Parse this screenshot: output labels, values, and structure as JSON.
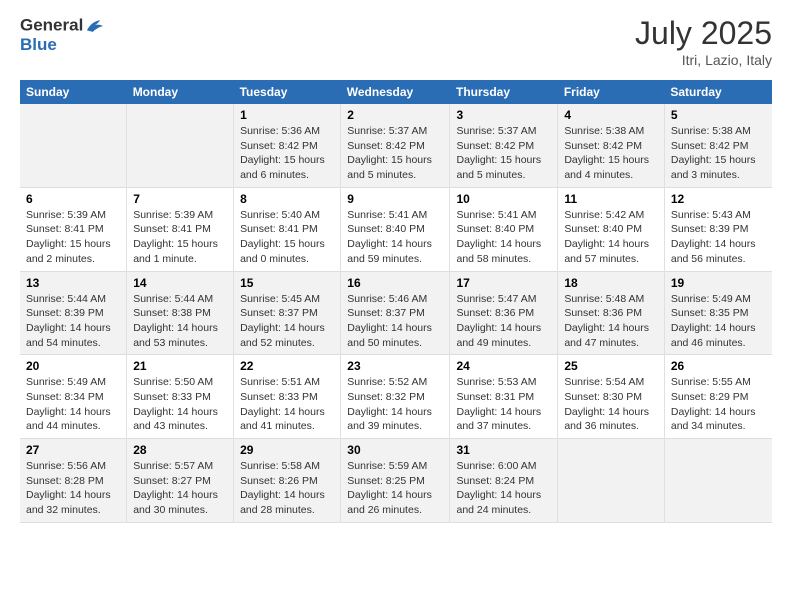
{
  "header": {
    "logo_general": "General",
    "logo_blue": "Blue",
    "month_year": "July 2025",
    "location": "Itri, Lazio, Italy"
  },
  "days_of_week": [
    "Sunday",
    "Monday",
    "Tuesday",
    "Wednesday",
    "Thursday",
    "Friday",
    "Saturday"
  ],
  "weeks": [
    [
      {
        "day": "",
        "sunrise": "",
        "sunset": "",
        "daylight": ""
      },
      {
        "day": "",
        "sunrise": "",
        "sunset": "",
        "daylight": ""
      },
      {
        "day": "1",
        "sunrise": "Sunrise: 5:36 AM",
        "sunset": "Sunset: 8:42 PM",
        "daylight": "Daylight: 15 hours and 6 minutes."
      },
      {
        "day": "2",
        "sunrise": "Sunrise: 5:37 AM",
        "sunset": "Sunset: 8:42 PM",
        "daylight": "Daylight: 15 hours and 5 minutes."
      },
      {
        "day": "3",
        "sunrise": "Sunrise: 5:37 AM",
        "sunset": "Sunset: 8:42 PM",
        "daylight": "Daylight: 15 hours and 5 minutes."
      },
      {
        "day": "4",
        "sunrise": "Sunrise: 5:38 AM",
        "sunset": "Sunset: 8:42 PM",
        "daylight": "Daylight: 15 hours and 4 minutes."
      },
      {
        "day": "5",
        "sunrise": "Sunrise: 5:38 AM",
        "sunset": "Sunset: 8:42 PM",
        "daylight": "Daylight: 15 hours and 3 minutes."
      }
    ],
    [
      {
        "day": "6",
        "sunrise": "Sunrise: 5:39 AM",
        "sunset": "Sunset: 8:41 PM",
        "daylight": "Daylight: 15 hours and 2 minutes."
      },
      {
        "day": "7",
        "sunrise": "Sunrise: 5:39 AM",
        "sunset": "Sunset: 8:41 PM",
        "daylight": "Daylight: 15 hours and 1 minute."
      },
      {
        "day": "8",
        "sunrise": "Sunrise: 5:40 AM",
        "sunset": "Sunset: 8:41 PM",
        "daylight": "Daylight: 15 hours and 0 minutes."
      },
      {
        "day": "9",
        "sunrise": "Sunrise: 5:41 AM",
        "sunset": "Sunset: 8:40 PM",
        "daylight": "Daylight: 14 hours and 59 minutes."
      },
      {
        "day": "10",
        "sunrise": "Sunrise: 5:41 AM",
        "sunset": "Sunset: 8:40 PM",
        "daylight": "Daylight: 14 hours and 58 minutes."
      },
      {
        "day": "11",
        "sunrise": "Sunrise: 5:42 AM",
        "sunset": "Sunset: 8:40 PM",
        "daylight": "Daylight: 14 hours and 57 minutes."
      },
      {
        "day": "12",
        "sunrise": "Sunrise: 5:43 AM",
        "sunset": "Sunset: 8:39 PM",
        "daylight": "Daylight: 14 hours and 56 minutes."
      }
    ],
    [
      {
        "day": "13",
        "sunrise": "Sunrise: 5:44 AM",
        "sunset": "Sunset: 8:39 PM",
        "daylight": "Daylight: 14 hours and 54 minutes."
      },
      {
        "day": "14",
        "sunrise": "Sunrise: 5:44 AM",
        "sunset": "Sunset: 8:38 PM",
        "daylight": "Daylight: 14 hours and 53 minutes."
      },
      {
        "day": "15",
        "sunrise": "Sunrise: 5:45 AM",
        "sunset": "Sunset: 8:37 PM",
        "daylight": "Daylight: 14 hours and 52 minutes."
      },
      {
        "day": "16",
        "sunrise": "Sunrise: 5:46 AM",
        "sunset": "Sunset: 8:37 PM",
        "daylight": "Daylight: 14 hours and 50 minutes."
      },
      {
        "day": "17",
        "sunrise": "Sunrise: 5:47 AM",
        "sunset": "Sunset: 8:36 PM",
        "daylight": "Daylight: 14 hours and 49 minutes."
      },
      {
        "day": "18",
        "sunrise": "Sunrise: 5:48 AM",
        "sunset": "Sunset: 8:36 PM",
        "daylight": "Daylight: 14 hours and 47 minutes."
      },
      {
        "day": "19",
        "sunrise": "Sunrise: 5:49 AM",
        "sunset": "Sunset: 8:35 PM",
        "daylight": "Daylight: 14 hours and 46 minutes."
      }
    ],
    [
      {
        "day": "20",
        "sunrise": "Sunrise: 5:49 AM",
        "sunset": "Sunset: 8:34 PM",
        "daylight": "Daylight: 14 hours and 44 minutes."
      },
      {
        "day": "21",
        "sunrise": "Sunrise: 5:50 AM",
        "sunset": "Sunset: 8:33 PM",
        "daylight": "Daylight: 14 hours and 43 minutes."
      },
      {
        "day": "22",
        "sunrise": "Sunrise: 5:51 AM",
        "sunset": "Sunset: 8:33 PM",
        "daylight": "Daylight: 14 hours and 41 minutes."
      },
      {
        "day": "23",
        "sunrise": "Sunrise: 5:52 AM",
        "sunset": "Sunset: 8:32 PM",
        "daylight": "Daylight: 14 hours and 39 minutes."
      },
      {
        "day": "24",
        "sunrise": "Sunrise: 5:53 AM",
        "sunset": "Sunset: 8:31 PM",
        "daylight": "Daylight: 14 hours and 37 minutes."
      },
      {
        "day": "25",
        "sunrise": "Sunrise: 5:54 AM",
        "sunset": "Sunset: 8:30 PM",
        "daylight": "Daylight: 14 hours and 36 minutes."
      },
      {
        "day": "26",
        "sunrise": "Sunrise: 5:55 AM",
        "sunset": "Sunset: 8:29 PM",
        "daylight": "Daylight: 14 hours and 34 minutes."
      }
    ],
    [
      {
        "day": "27",
        "sunrise": "Sunrise: 5:56 AM",
        "sunset": "Sunset: 8:28 PM",
        "daylight": "Daylight: 14 hours and 32 minutes."
      },
      {
        "day": "28",
        "sunrise": "Sunrise: 5:57 AM",
        "sunset": "Sunset: 8:27 PM",
        "daylight": "Daylight: 14 hours and 30 minutes."
      },
      {
        "day": "29",
        "sunrise": "Sunrise: 5:58 AM",
        "sunset": "Sunset: 8:26 PM",
        "daylight": "Daylight: 14 hours and 28 minutes."
      },
      {
        "day": "30",
        "sunrise": "Sunrise: 5:59 AM",
        "sunset": "Sunset: 8:25 PM",
        "daylight": "Daylight: 14 hours and 26 minutes."
      },
      {
        "day": "31",
        "sunrise": "Sunrise: 6:00 AM",
        "sunset": "Sunset: 8:24 PM",
        "daylight": "Daylight: 14 hours and 24 minutes."
      },
      {
        "day": "",
        "sunrise": "",
        "sunset": "",
        "daylight": ""
      },
      {
        "day": "",
        "sunrise": "",
        "sunset": "",
        "daylight": ""
      }
    ]
  ]
}
